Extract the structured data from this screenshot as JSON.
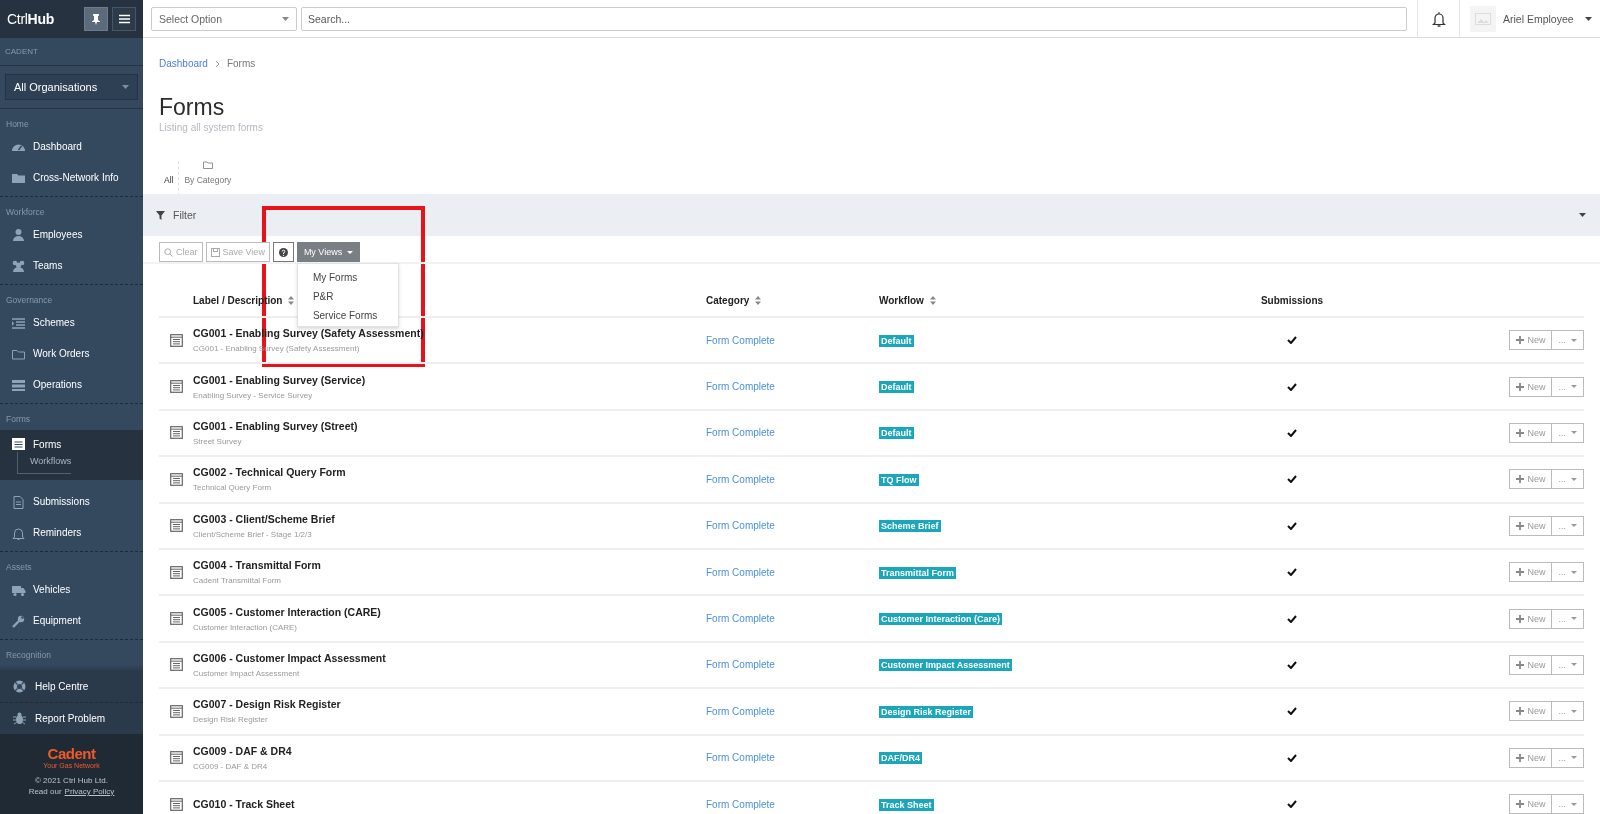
{
  "brand": {
    "light": "Ctrl",
    "bold": "Hub"
  },
  "sidebar": {
    "org_label": "CADENT",
    "org_select": "All Organisations",
    "sections": [
      {
        "title": "Home",
        "items": [
          {
            "label": "Dashboard",
            "selected": false
          },
          {
            "label": "Cross-Network Info",
            "selected": false
          }
        ]
      },
      {
        "title": "Workforce",
        "items": [
          {
            "label": "Employees",
            "selected": false
          },
          {
            "label": "Teams",
            "selected": false
          }
        ]
      },
      {
        "title": "Governance",
        "items": [
          {
            "label": "Schemes",
            "selected": false
          },
          {
            "label": "Work Orders",
            "selected": false
          },
          {
            "label": "Operations",
            "selected": false
          }
        ]
      },
      {
        "title": "Forms",
        "items": [
          {
            "label": "Forms",
            "selected": true,
            "children": [
              {
                "label": "Workflows",
                "selected": false
              }
            ]
          },
          {
            "label": "Submissions",
            "selected": false
          },
          {
            "label": "Reminders",
            "selected": false
          }
        ]
      },
      {
        "title": "Assets",
        "items": [
          {
            "label": "Vehicles",
            "selected": false
          },
          {
            "label": "Equipment",
            "selected": false
          }
        ]
      },
      {
        "title": "Recognition"
      }
    ],
    "bottom_links": [
      "Help Centre",
      "Report Problem"
    ],
    "footer": {
      "logo": "Cadent",
      "tagline": "Your Gas Network",
      "copyright": "© 2021 Ctrl Hub Ltd.",
      "privacy_prefix": "Read our",
      "privacy_link": "Privacy Policy"
    }
  },
  "topbar": {
    "select": {
      "placeholder": "Select Option"
    },
    "search": {
      "placeholder": "Search..."
    },
    "user": "Ariel Employee"
  },
  "breadcrumb": [
    "Dashboard",
    "Forms"
  ],
  "page": {
    "title": "Forms",
    "subtitle": "Listing all system forms"
  },
  "tabs": [
    {
      "label": "All",
      "selected": true
    },
    {
      "label": "By Category",
      "selected": false
    }
  ],
  "filter": {
    "label": "Filter",
    "expanded": false
  },
  "toolbar": {
    "clear": "Clear",
    "save_view": "Save View",
    "my_views": "My Views"
  },
  "my_views_menu": [
    "My Forms",
    "P&R",
    "Service Forms"
  ],
  "table": {
    "columns": [
      "Label / Description",
      "Category",
      "Workflow",
      "Submissions"
    ],
    "rows": [
      {
        "title": "CG001 - Enabling Survey (Safety Assessment)",
        "description": "CG001 - Enabling Survey (Safety Assessment)",
        "category": "Form Complete",
        "workflow": "Default",
        "submissions": true,
        "new": "New",
        "more": "..."
      },
      {
        "title": "CG001 - Enabling Survey (Service)",
        "description": "Enabling Survey - Service Survey",
        "category": "Form Complete",
        "workflow": "Default",
        "submissions": true,
        "new": "New",
        "more": "..."
      },
      {
        "title": "CG001 - Enabling Survey (Street)",
        "description": "Street Survey",
        "category": "Form Complete",
        "workflow": "Default",
        "submissions": true,
        "new": "New",
        "more": "..."
      },
      {
        "title": "CG002 - Technical Query Form",
        "description": "Technical Query Form",
        "category": "Form Complete",
        "workflow": "TQ Flow",
        "submissions": true,
        "new": "New",
        "more": "..."
      },
      {
        "title": "CG003 - Client/Scheme Brief",
        "description": "Client/Scheme Brief - Stage 1/2/3",
        "category": "Form Complete",
        "workflow": "Scheme Brief",
        "submissions": true,
        "new": "New",
        "more": "..."
      },
      {
        "title": "CG004 - Transmittal Form",
        "description": "Cadent Transmittal Form",
        "category": "Form Complete",
        "workflow": "Transmittal Form",
        "submissions": true,
        "new": "New",
        "more": "..."
      },
      {
        "title": "CG005 - Customer Interaction (CARE)",
        "description": "Customer Interaction (CARE)",
        "category": "Form Complete",
        "workflow": "Customer Interaction (Care)",
        "submissions": true,
        "new": "New",
        "more": "..."
      },
      {
        "title": "CG006 - Customer Impact Assessment",
        "description": "Customer Impact Assessment",
        "category": "Form Complete",
        "workflow": "Customer Impact Assessment",
        "submissions": true,
        "new": "New",
        "more": "..."
      },
      {
        "title": "CG007 - Design Risk Register",
        "description": "Design Risk Register",
        "category": "Form Complete",
        "workflow": "Design Risk Register",
        "submissions": true,
        "new": "New",
        "more": "..."
      },
      {
        "title": "CG009 - DAF & DR4",
        "description": "CG009 - DAF & DR4",
        "category": "Form Complete",
        "workflow": "DAF/DR4",
        "submissions": true,
        "new": "New",
        "more": "..."
      },
      {
        "title": "CG010 - Track Sheet",
        "category": "Form Complete",
        "workflow": "Track Sheet",
        "submissions": true,
        "new": "New",
        "more": "..."
      }
    ]
  }
}
